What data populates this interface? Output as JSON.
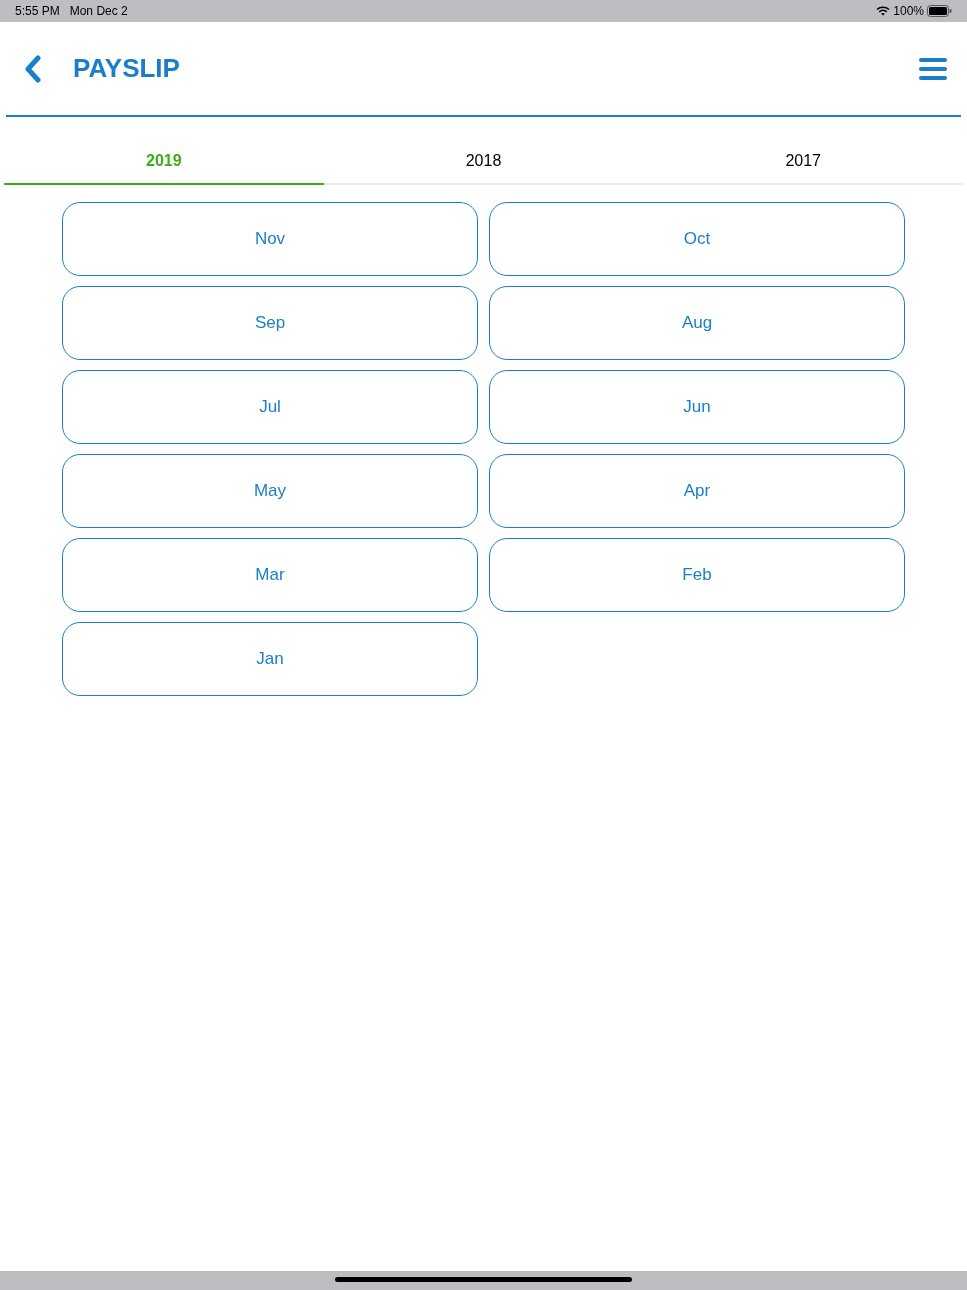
{
  "status_bar": {
    "time": "5:55 PM",
    "date": "Mon Dec 2",
    "battery": "100%"
  },
  "header": {
    "title": "PAYSLIP"
  },
  "tabs": [
    {
      "label": "2019",
      "selected": true
    },
    {
      "label": "2018",
      "selected": false
    },
    {
      "label": "2017",
      "selected": false
    }
  ],
  "months": [
    "Nov",
    "Oct",
    "Sep",
    "Aug",
    "Jul",
    "Jun",
    "May",
    "Apr",
    "Mar",
    "Feb",
    "Jan"
  ]
}
